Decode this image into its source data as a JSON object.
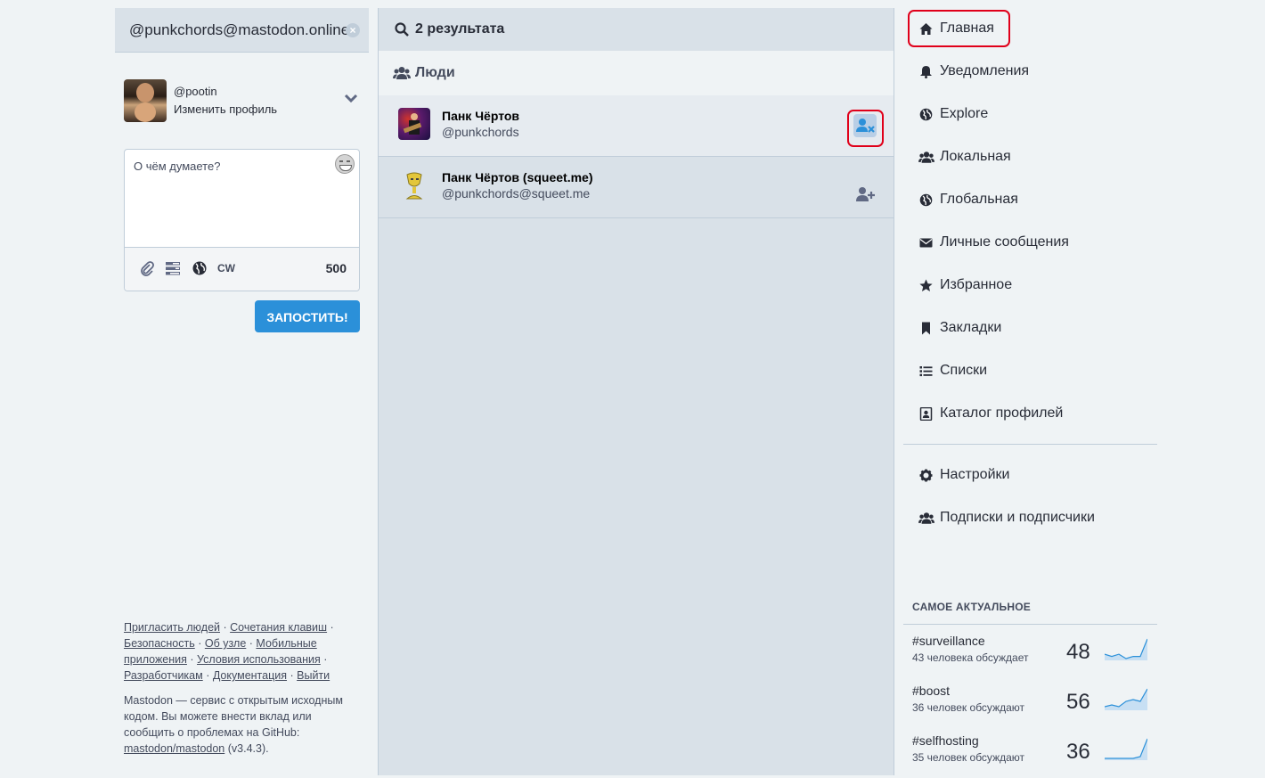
{
  "search": {
    "query": "@punkchords@mastodon.online",
    "clear_icon": "close-circle-icon"
  },
  "profile": {
    "handle": "@pootin",
    "edit_label": "Изменить профиль"
  },
  "composer": {
    "placeholder": "О чём думаете?",
    "cw_label": "CW",
    "char_count": "500",
    "publish_label": "ЗАПОСТИТЬ!"
  },
  "footer": {
    "links": [
      "Пригласить людей",
      "Сочетания клавиш",
      "Безопасность",
      "Об узле",
      "Мобильные приложения",
      "Условия использования",
      "Разработчикам",
      "Документация",
      "Выйти"
    ],
    "about_text": "Mastodon — сервис с открытым исходным кодом. Вы можете внести вклад или сообщить о проблемах на GitHub:",
    "repo_link": "mastodon/mastodon",
    "version": "(v3.4.3)."
  },
  "results": {
    "header": "2 результата",
    "section_label": "Люди",
    "accounts": [
      {
        "name": "Панк Чёртов",
        "handle": "@punkchords",
        "action": "unfollow-icon"
      },
      {
        "name": "Панк Чёртов (squeet.me)",
        "handle": "@punkchords@squeet.me",
        "action": "follow-icon"
      }
    ]
  },
  "nav": {
    "items": [
      {
        "label": "Главная",
        "icon": "home-icon"
      },
      {
        "label": "Уведомления",
        "icon": "bell-icon"
      },
      {
        "label": "Explore",
        "icon": "globe-icon"
      },
      {
        "label": "Локальная",
        "icon": "users-icon"
      },
      {
        "label": "Глобальная",
        "icon": "globe-icon"
      },
      {
        "label": "Личные сообщения",
        "icon": "envelope-icon"
      },
      {
        "label": "Избранное",
        "icon": "star-icon"
      },
      {
        "label": "Закладки",
        "icon": "bookmark-icon"
      },
      {
        "label": "Списки",
        "icon": "list-icon"
      },
      {
        "label": "Каталог профилей",
        "icon": "address-book-icon"
      }
    ],
    "secondary": [
      {
        "label": "Настройки",
        "icon": "gear-icon"
      },
      {
        "label": "Подписки и подписчики",
        "icon": "users-icon"
      }
    ]
  },
  "trends": {
    "title": "САМОЕ АКТУАЛЬНОЕ",
    "items": [
      {
        "tag": "#surveillance",
        "people": "43 человека обсуждает",
        "count": "48",
        "spark": [
          2,
          1,
          2,
          0,
          1,
          1,
          9
        ]
      },
      {
        "tag": "#boost",
        "people": "36 человек обсуждают",
        "count": "56",
        "spark": [
          1,
          2,
          1,
          4,
          5,
          4,
          11
        ]
      },
      {
        "tag": "#selfhosting",
        "people": "35 человек обсуждают",
        "count": "36",
        "spark": [
          0,
          0,
          0,
          0,
          0,
          1,
          11
        ]
      }
    ]
  },
  "colors": {
    "accent": "#2b90d9",
    "highlight": "#e0001a",
    "background": "#eff3f5",
    "panel": "#d9e1e8"
  }
}
